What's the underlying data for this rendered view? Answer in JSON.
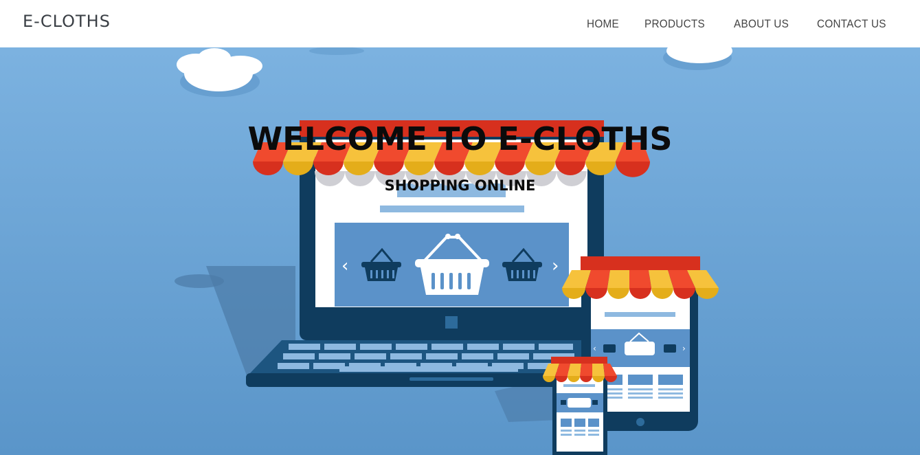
{
  "brand": {
    "name": "E-CLOTHS"
  },
  "nav": {
    "items": [
      {
        "label": "HOME"
      },
      {
        "label": "PRODUCTS"
      },
      {
        "label": "ABOUT US"
      },
      {
        "label": "CONTACT US"
      }
    ]
  },
  "hero": {
    "title": "WELCOME TO E-CLOTHS",
    "subtitle": "SHOPPING ONLINE",
    "illustration": "online-store-devices-illustration"
  },
  "colors": {
    "sky": "#6fa6d8",
    "awning_red": "#d7301e",
    "awning_yellow": "#e4ad1a",
    "device_navy": "#0f3c5e",
    "screen_blue": "#5b92c9"
  }
}
